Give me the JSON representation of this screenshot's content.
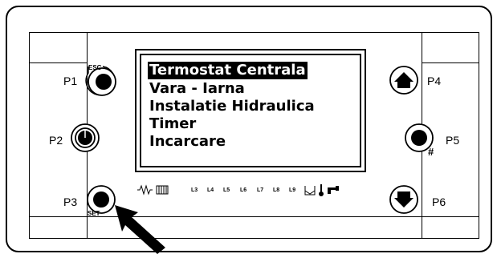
{
  "screen": {
    "menu_items": [
      {
        "label": "Termostat Centrala",
        "selected": true
      },
      {
        "label": "Vara - Iarna",
        "selected": false
      },
      {
        "label": "Instalatie Hidraulica",
        "selected": false
      },
      {
        "label": "Timer",
        "selected": false
      },
      {
        "label": "Incarcare",
        "selected": false
      }
    ]
  },
  "buttons": {
    "p1": {
      "label": "P1",
      "tag": "ESC",
      "icon": "filled-circle-icon"
    },
    "p2": {
      "label": "P2",
      "icon": "power-icon"
    },
    "p3": {
      "label": "P3",
      "tag": "SET",
      "icon": "filled-circle-icon"
    },
    "p4": {
      "label": "P4",
      "icon": "arrow-up-icon"
    },
    "p5": {
      "label": "P5",
      "tag": "#",
      "icon": "filled-circle-icon"
    },
    "p6": {
      "label": "P6",
      "icon": "arrow-down-icon"
    }
  },
  "indicators": {
    "labels": [
      "L3",
      "L4",
      "L5",
      "L6",
      "L7",
      "L8",
      "L9"
    ],
    "icons": [
      "resistor-icon",
      "coil-icon",
      "tank-icon",
      "thermometer-icon",
      "tap-icon"
    ]
  },
  "colors": {
    "foreground": "#000000",
    "background": "#ffffff",
    "highlight_bg": "#000000",
    "highlight_fg": "#ffffff"
  }
}
